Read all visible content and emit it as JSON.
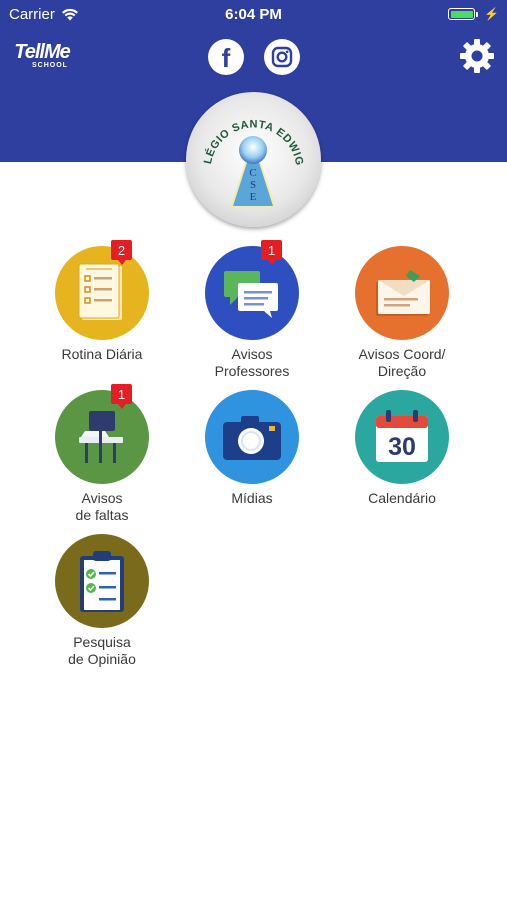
{
  "status_bar": {
    "carrier": "Carrier",
    "time": "6:04 PM"
  },
  "header": {
    "logo_brand": "TellMe",
    "logo_sub": "SCHOOL",
    "facebook_icon": "facebook-icon",
    "instagram_icon": "instagram-icon",
    "settings_icon": "gear-icon",
    "background_color": "#2f3f9f"
  },
  "school_seal": {
    "name": "COLÉGIO SANTA EDWIGES",
    "initials": [
      "C",
      "S",
      "E"
    ]
  },
  "menu": {
    "rotina": {
      "label": "Rotina Diária",
      "badge": "2",
      "color": "#e6b41e",
      "icon": "checklist-icon"
    },
    "professores": {
      "label": "Avisos\nProfessores",
      "badge": "1",
      "color": "#2e4fbf",
      "icon": "chat-bubbles-icon"
    },
    "coord": {
      "label": "Avisos Coord/\nDireção",
      "color": "#e6702e",
      "icon": "envelope-icon"
    },
    "faltas": {
      "label": "Avisos\nde faltas",
      "badge": "1",
      "color": "#5a9644",
      "icon": "school-desk-icon"
    },
    "midias": {
      "label": "Mídias",
      "color": "#2f93e0",
      "icon": "camera-icon"
    },
    "calendario": {
      "label": "Calendário",
      "day": "30",
      "color": "#2aa8a0",
      "icon": "calendar-icon"
    },
    "pesquisa": {
      "label": "Pesquisa\nde Opinião",
      "color": "#7a6a1c",
      "icon": "clipboard-check-icon"
    }
  }
}
